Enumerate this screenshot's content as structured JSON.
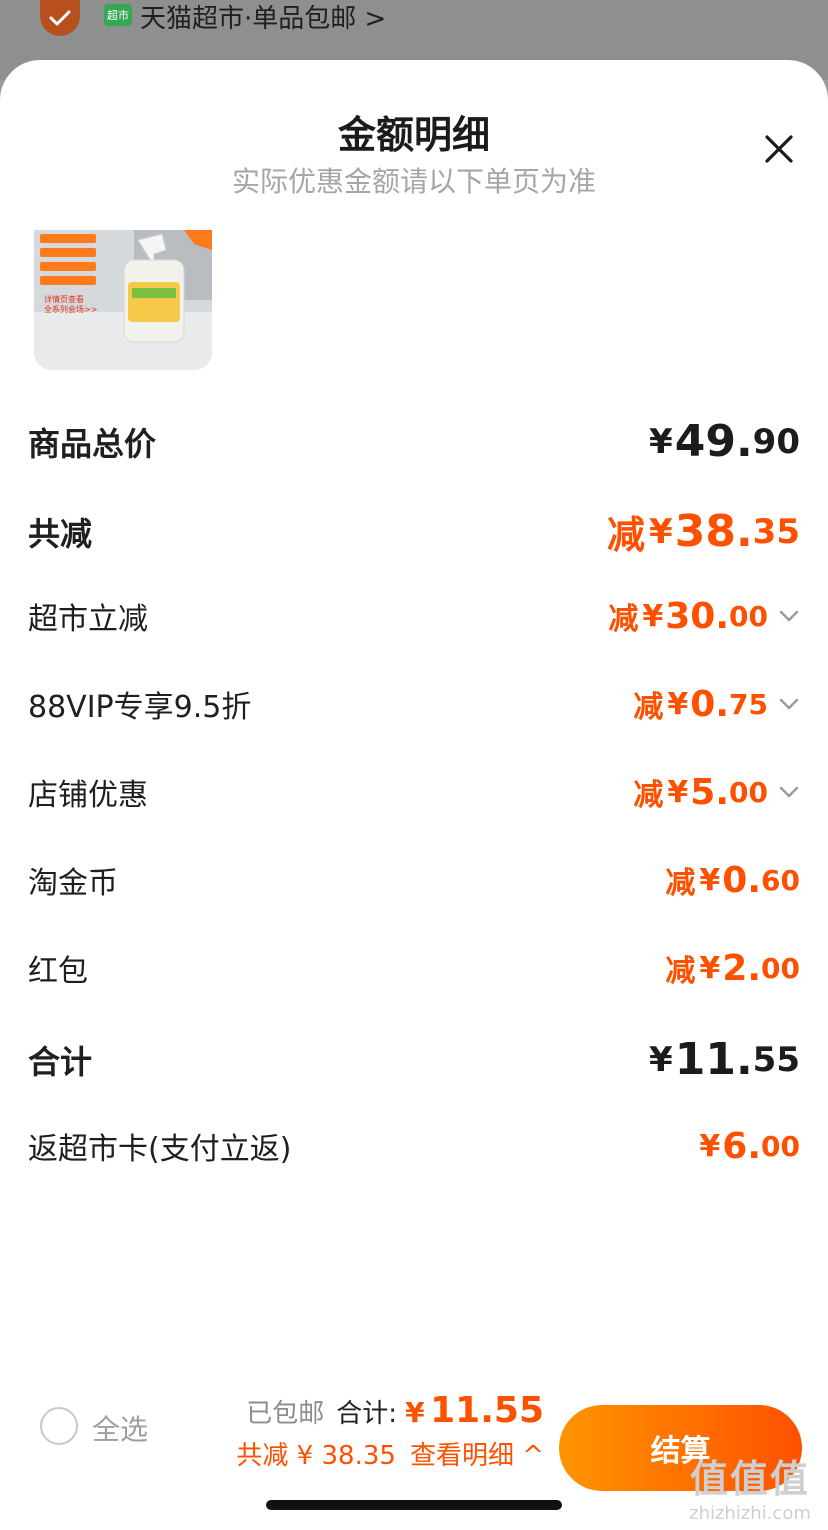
{
  "top_bar": {
    "store_text": "天猫超市·单品包邮 >",
    "badge_text": "超市"
  },
  "sheet": {
    "title": "金额明细",
    "subtitle": "实际优惠金额请以下单页为准"
  },
  "rows": {
    "goods_total": {
      "label": "商品总价",
      "yen": "¥",
      "int": "49.",
      "dec": "90"
    },
    "total_discount": {
      "label": "共减",
      "prefix": "减",
      "yen": "¥",
      "int": "38.",
      "dec": "35"
    },
    "supermarket_discount": {
      "label": "超市立减",
      "prefix": "减",
      "yen": "¥",
      "int": "30.",
      "dec": "00"
    },
    "vip_discount": {
      "label": "88VIP专享9.5折",
      "prefix": "减",
      "yen": "¥",
      "int": "0.",
      "dec": "75"
    },
    "store_coupon": {
      "label": "店铺优惠",
      "prefix": "减",
      "yen": "¥",
      "int": "5.",
      "dec": "00"
    },
    "taojin_coins": {
      "label": "淘金币",
      "prefix": "减",
      "yen": "¥",
      "int": "0.",
      "dec": "60"
    },
    "red_packet": {
      "label": "红包",
      "prefix": "减",
      "yen": "¥",
      "int": "2.",
      "dec": "00"
    },
    "subtotal": {
      "label": "合计",
      "yen": "¥",
      "int": "11.",
      "dec": "55"
    },
    "cashback": {
      "label": "返超市卡(支付立返)",
      "yen": "¥",
      "int": "6.",
      "dec": "00"
    }
  },
  "bottom_bar": {
    "select_all": "全选",
    "free_shipping": "已包邮",
    "total_label": "合计:",
    "total_yen": "¥",
    "total_value": "11.55",
    "discount_text": "共减 ¥ 38.35",
    "view_detail": "查看明细 ^",
    "checkout": "结算"
  },
  "watermark": {
    "logo": "值值值",
    "url": "zhizhizhi.com"
  },
  "colors": {
    "accent": "#ff5000",
    "accent_light": "#ff9500",
    "text": "#1f1f1f",
    "muted": "#a6a6a6"
  },
  "icons": [
    "check-icon",
    "close-icon",
    "chevron-down-icon",
    "chevron-up-icon"
  ]
}
